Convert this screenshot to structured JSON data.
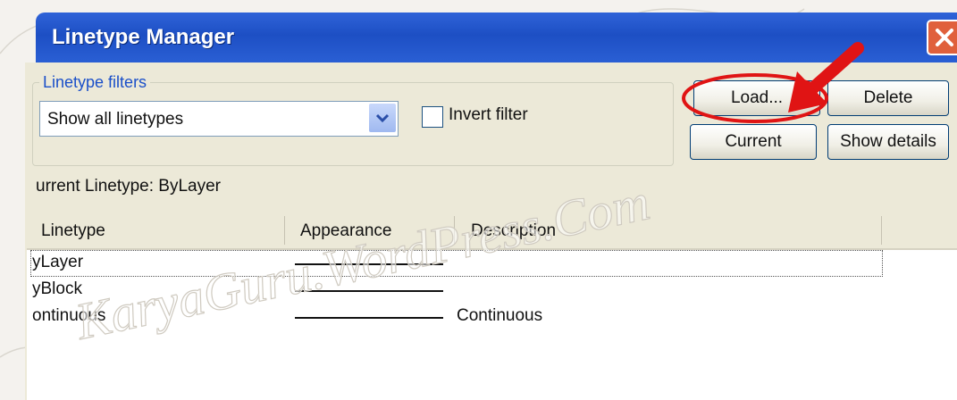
{
  "window": {
    "title": "Linetype Manager"
  },
  "filters": {
    "group_label": "Linetype filters",
    "selected": "Show all linetypes",
    "invert_label": "Invert filter",
    "invert_checked": false
  },
  "buttons": {
    "load": "Load...",
    "delete": "Delete",
    "current": "Current",
    "show_details": "Show details"
  },
  "current_linetype": "urrent Linetype:  ByLayer",
  "list": {
    "columns": [
      "Linetype",
      "Appearance",
      "Description"
    ],
    "rows": [
      {
        "linetype": "yLayer",
        "description": ""
      },
      {
        "linetype": "yBlock",
        "description": ""
      },
      {
        "linetype": "ontinuous",
        "description": "Continuous"
      }
    ]
  },
  "watermark": "KaryaGuru.WordPress.Com",
  "colors": {
    "title_bar": "#1d4fc4",
    "annotation": "#e01414",
    "group_label": "#1a4fc9"
  },
  "icons": {
    "combo_arrow": "chevron-down-icon",
    "close": "close-icon",
    "annotation": "arrow-icon"
  }
}
